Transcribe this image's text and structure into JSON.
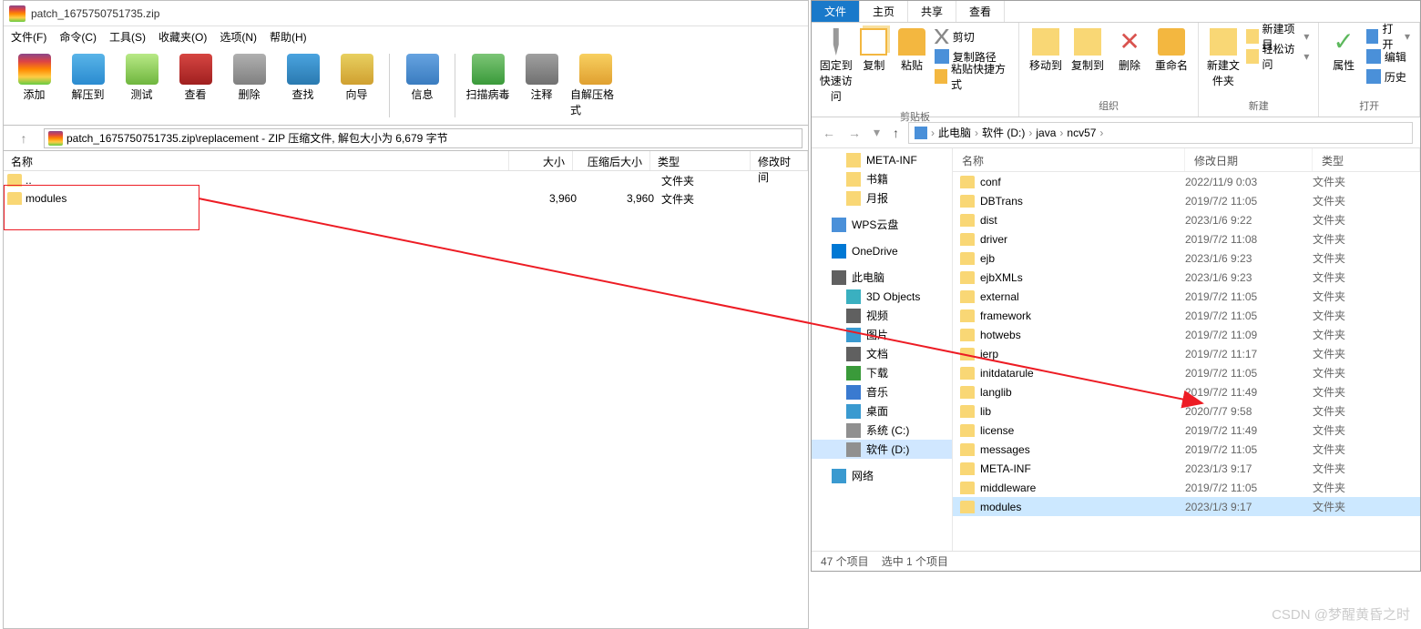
{
  "winrar": {
    "title": "patch_1675750751735.zip",
    "menu": [
      "文件(F)",
      "命令(C)",
      "工具(S)",
      "收藏夹(O)",
      "选项(N)",
      "帮助(H)"
    ],
    "toolbar": [
      {
        "label": "添加",
        "color": "linear-gradient(#8b4789,#d44,#f80,#fc4,#6c4)"
      },
      {
        "label": "解压到",
        "color": "linear-gradient(#59b4e8,#2a8bd0)"
      },
      {
        "label": "测试",
        "color": "linear-gradient(#b8e986,#6fb63e)"
      },
      {
        "label": "查看",
        "color": "linear-gradient(#d64541,#a02020)"
      },
      {
        "label": "删除",
        "color": "linear-gradient(#b0b0b0,#808080)"
      },
      {
        "label": "查找",
        "color": "linear-gradient(#4aa3df,#2a7ab0)"
      },
      {
        "label": "向导",
        "color": "linear-gradient(#e8d060,#d0a030)"
      },
      {
        "label": "信息",
        "color": "linear-gradient(#66a3e0,#3a7cc0)"
      },
      {
        "label": "扫描病毒",
        "color": "linear-gradient(#7cc576,#3a9a3a)"
      },
      {
        "label": "注释",
        "color": "linear-gradient(#a0a0a0,#707070)"
      },
      {
        "label": "自解压格式",
        "color": "linear-gradient(#f8d060,#e0a030)"
      }
    ],
    "path": "patch_1675750751735.zip\\replacement - ZIP 压缩文件, 解包大小为 6,679 字节",
    "columns": {
      "name": "名称",
      "size": "大小",
      "packed": "压缩后大小",
      "type": "类型",
      "date": "修改时间"
    },
    "rows": [
      {
        "name": "..",
        "size": "",
        "packed": "",
        "type": "文件夹",
        "date": ""
      },
      {
        "name": "modules",
        "size": "3,960",
        "packed": "3,960",
        "type": "文件夹",
        "date": ""
      }
    ]
  },
  "explorer": {
    "tabs": [
      "文件",
      "主页",
      "共享",
      "查看"
    ],
    "ribbon": {
      "clipboard": {
        "pin": "固定到快速访问",
        "copy": "复制",
        "paste": "粘贴",
        "cut": "剪切",
        "copypath": "复制路径",
        "pasteshortcut": "粘贴快捷方式",
        "label": "剪贴板"
      },
      "organize": {
        "moveto": "移动到",
        "copyto": "复制到",
        "delete": "删除",
        "rename": "重命名",
        "label": "组织"
      },
      "new": {
        "newfolder": "新建文件夹",
        "newitem": "新建项目",
        "easyaccess": "轻松访问",
        "label": "新建"
      },
      "open": {
        "properties": "属性",
        "open": "打开",
        "edit": "编辑",
        "history": "历史",
        "label": "打开"
      }
    },
    "breadcrumb": [
      "此电脑",
      "软件 (D:)",
      "java",
      "ncv57"
    ],
    "navPane": [
      {
        "label": "META-INF",
        "icon": "folder",
        "level": 2
      },
      {
        "label": "书籍",
        "icon": "folder",
        "level": 2
      },
      {
        "label": "月报",
        "icon": "folder",
        "level": 2
      },
      {
        "label": "WPS云盘",
        "icon": "wps",
        "level": 1,
        "spacer": true
      },
      {
        "label": "OneDrive",
        "icon": "onedrive",
        "level": 1,
        "spacer": true
      },
      {
        "label": "此电脑",
        "icon": "pc",
        "level": 1,
        "spacer": true
      },
      {
        "label": "3D Objects",
        "icon": "3d",
        "level": 2
      },
      {
        "label": "视频",
        "icon": "video",
        "level": 2
      },
      {
        "label": "图片",
        "icon": "pic",
        "level": 2
      },
      {
        "label": "文档",
        "icon": "doc",
        "level": 2
      },
      {
        "label": "下载",
        "icon": "download",
        "level": 2
      },
      {
        "label": "音乐",
        "icon": "music",
        "level": 2
      },
      {
        "label": "桌面",
        "icon": "desktop",
        "level": 2
      },
      {
        "label": "系统 (C:)",
        "icon": "disk",
        "level": 2
      },
      {
        "label": "软件 (D:)",
        "icon": "disk",
        "level": 2,
        "selected": true
      },
      {
        "label": "网络",
        "icon": "network",
        "level": 1,
        "spacer": true
      }
    ],
    "contentHeader": {
      "name": "名称",
      "date": "修改日期",
      "type": "类型"
    },
    "files": [
      {
        "name": "conf",
        "date": "2022/11/9 0:03",
        "type": "文件夹"
      },
      {
        "name": "DBTrans",
        "date": "2019/7/2 11:05",
        "type": "文件夹"
      },
      {
        "name": "dist",
        "date": "2023/1/6 9:22",
        "type": "文件夹"
      },
      {
        "name": "driver",
        "date": "2019/7/2 11:08",
        "type": "文件夹"
      },
      {
        "name": "ejb",
        "date": "2023/1/6 9:23",
        "type": "文件夹"
      },
      {
        "name": "ejbXMLs",
        "date": "2023/1/6 9:23",
        "type": "文件夹"
      },
      {
        "name": "external",
        "date": "2019/7/2 11:05",
        "type": "文件夹"
      },
      {
        "name": "framework",
        "date": "2019/7/2 11:05",
        "type": "文件夹"
      },
      {
        "name": "hotwebs",
        "date": "2019/7/2 11:09",
        "type": "文件夹"
      },
      {
        "name": "ierp",
        "date": "2019/7/2 11:17",
        "type": "文件夹"
      },
      {
        "name": "initdatarule",
        "date": "2019/7/2 11:05",
        "type": "文件夹"
      },
      {
        "name": "langlib",
        "date": "2019/7/2 11:49",
        "type": "文件夹"
      },
      {
        "name": "lib",
        "date": "2020/7/7 9:58",
        "type": "文件夹"
      },
      {
        "name": "license",
        "date": "2019/7/2 11:49",
        "type": "文件夹"
      },
      {
        "name": "messages",
        "date": "2019/7/2 11:05",
        "type": "文件夹"
      },
      {
        "name": "META-INF",
        "date": "2023/1/3 9:17",
        "type": "文件夹"
      },
      {
        "name": "middleware",
        "date": "2019/7/2 11:05",
        "type": "文件夹"
      },
      {
        "name": "modules",
        "date": "2023/1/3 9:17",
        "type": "文件夹",
        "selected": true
      }
    ],
    "status": {
      "count": "47 个项目",
      "selected": "选中 1 个项目"
    }
  },
  "watermark": "CSDN @梦醒黄昏之时"
}
